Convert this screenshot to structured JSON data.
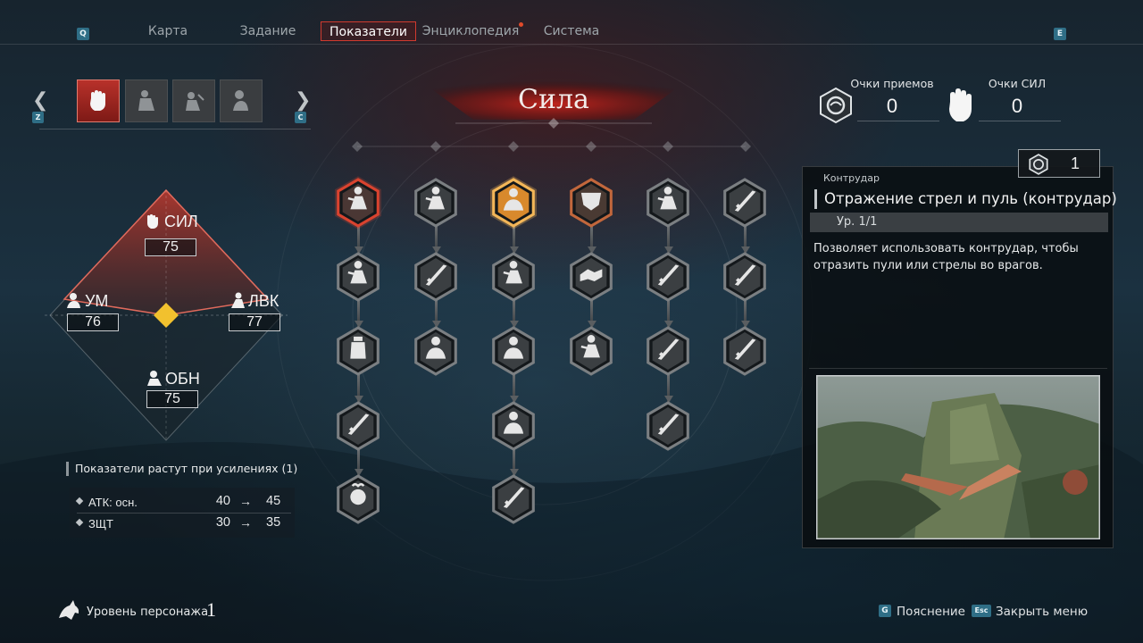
{
  "nav": {
    "left_key": "Q",
    "right_key": "E",
    "tabs": [
      {
        "label": "Карта"
      },
      {
        "label": "Задание"
      },
      {
        "label": "Показатели"
      },
      {
        "label": "Энциклопедия"
      },
      {
        "label": "Система"
      }
    ]
  },
  "category": {
    "prev_key": "Z",
    "next_key": "C",
    "title": "Сила",
    "icons": [
      "fist-icon",
      "dexterity-icon",
      "charm-icon",
      "wisdom-icon"
    ]
  },
  "stats": {
    "str": {
      "label": "СИЛ",
      "value": "75"
    },
    "int": {
      "label": "УМ",
      "value": "76"
    },
    "dex": {
      "label": "ЛВК",
      "value": "77"
    },
    "cha": {
      "label": "ОБН",
      "value": "75"
    }
  },
  "growth": {
    "title": "Показатели растут при усилениях (1)",
    "rows": [
      {
        "name": "АТК: осн.",
        "from": "40",
        "arrow": "→",
        "to": "45"
      },
      {
        "name": "ЗЩТ",
        "from": "30",
        "arrow": "→",
        "to": "35"
      }
    ]
  },
  "points": {
    "technique_label": "Очки приемов",
    "technique_value": "0",
    "strength_label": "Очки СИЛ",
    "strength_value": "0"
  },
  "detail": {
    "cost": "1",
    "category": "Контрудар",
    "title": "Отражение стрел и пуль (контрудар)",
    "level": "Ур. 1/1",
    "description": "Позволяет использовать контрудар, чтобы отразить пули или стрелы во врагов."
  },
  "footer": {
    "level_label": "Уровень персонажа",
    "level_value": "1",
    "hint_key": "G",
    "hint_label": "Пояснение",
    "close_key": "Esc",
    "close_label": "Закрыть меню"
  },
  "colors": {
    "accent_red": "#d13a2f",
    "selected_gold": "#f0a94a",
    "stat_diamond_center": "#f2c12e",
    "keycap_blue": "#2f6e86"
  }
}
